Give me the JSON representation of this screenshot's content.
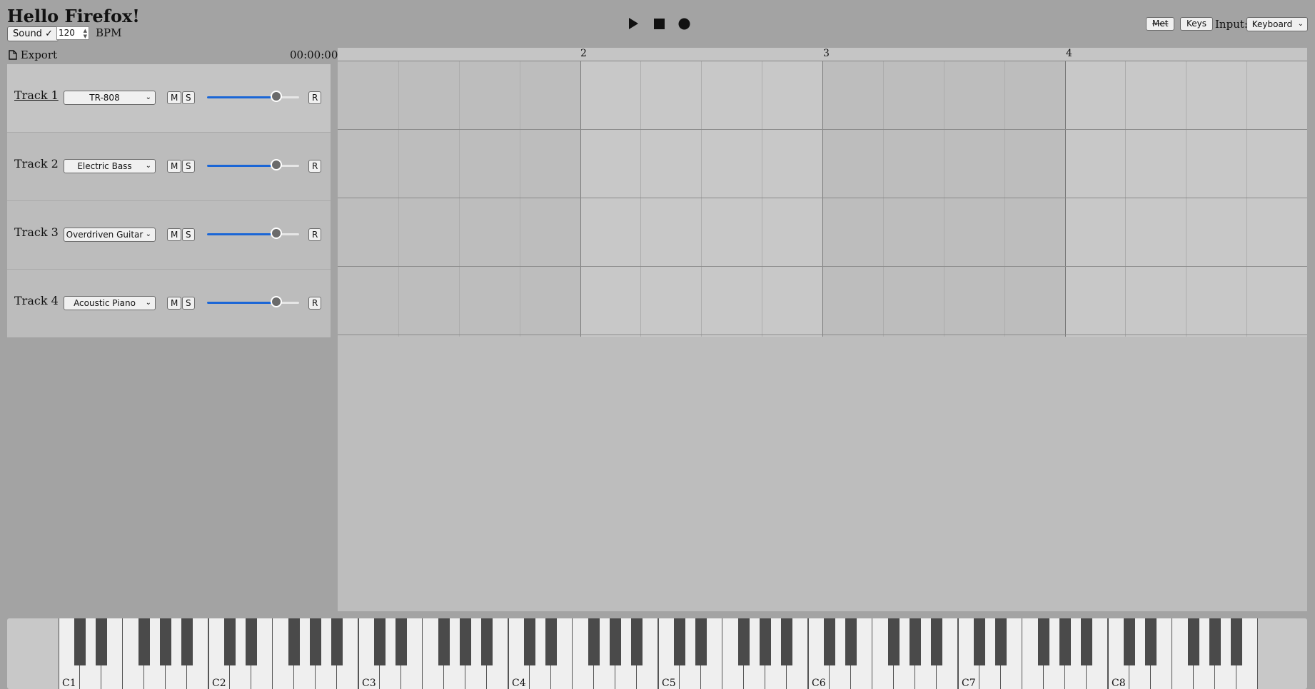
{
  "app": {
    "title": "Hello Firefox!"
  },
  "toolbar": {
    "sound_label": "Sound ✓",
    "bpm_value": "120",
    "bpm_label": "BPM",
    "metronome_label": "Met",
    "keys_label": "Keys",
    "input_label": "Input:",
    "input_selected": "Keyboard"
  },
  "transport": {
    "play_icon": "play-icon",
    "stop_icon": "stop-icon",
    "record_icon": "record-icon"
  },
  "panel": {
    "export_label": "Export",
    "time": "00:00:00"
  },
  "tracks": [
    {
      "name": "Track 1",
      "instrument": "TR-808",
      "mute": "M",
      "solo": "S",
      "record": "R",
      "volume": 0.75
    },
    {
      "name": "Track 2",
      "instrument": "Electric Bass",
      "mute": "M",
      "solo": "S",
      "record": "R",
      "volume": 0.75
    },
    {
      "name": "Track 3",
      "instrument": "Overdriven Guitar",
      "mute": "M",
      "solo": "S",
      "record": "R",
      "volume": 0.75
    },
    {
      "name": "Track 4",
      "instrument": "Acoustic Piano",
      "mute": "M",
      "solo": "S",
      "record": "R",
      "volume": 0.75
    }
  ],
  "timeline": {
    "bar_labels": [
      "2",
      "3",
      "4"
    ]
  },
  "piano": {
    "octave_labels": [
      "C1",
      "C2",
      "C3",
      "C4",
      "C5",
      "C6",
      "C7",
      "C8"
    ]
  },
  "colors": {
    "accent": "#1a66d6",
    "background": "#a3a3a3",
    "panel": "#bdbdbd"
  }
}
